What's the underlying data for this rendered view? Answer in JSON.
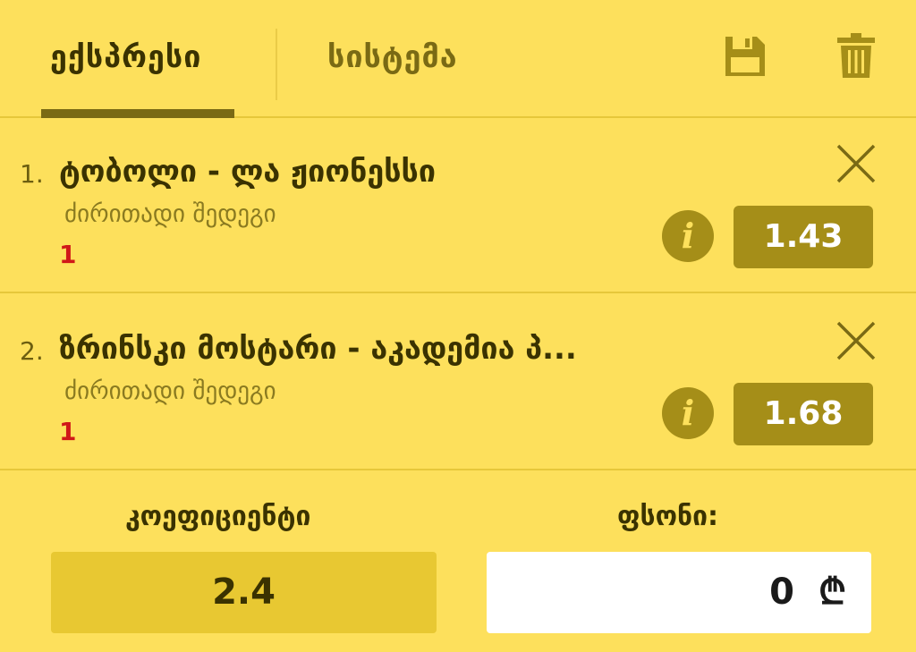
{
  "tabs": {
    "express_label": "ექსპრესი",
    "system_label": "სისტემა"
  },
  "toolbar": {
    "save_icon": "save-icon",
    "trash_icon": "trash-icon"
  },
  "bets": [
    {
      "number": "1.",
      "match": "ტობოლი - ლა ჟიონესსი",
      "market": "ძირითადი შედეგი",
      "selection": "1",
      "odds": "1.43"
    },
    {
      "number": "2.",
      "match": "ზრინსკი მოსტარი - აკადემია პ...",
      "market": "ძირითადი შედეგი",
      "selection": "1",
      "odds": "1.68"
    }
  ],
  "summary": {
    "coefficient_label": "კოეფიციენტი",
    "coefficient_value": "2.4",
    "stake_label": "ფსონი:",
    "stake_value": "0",
    "currency_symbol": "₾"
  },
  "colors": {
    "background": "#fde05c",
    "accent": "#a58e18",
    "selection": "#d01818"
  }
}
